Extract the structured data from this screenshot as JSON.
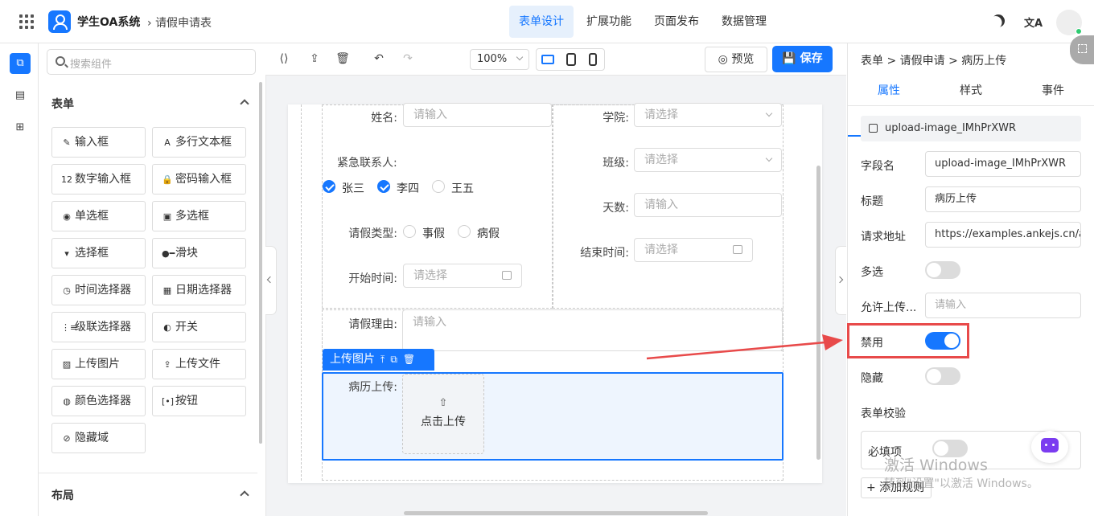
{
  "app": {
    "title": "学生OA系统",
    "breadcrumb": "请假申请表"
  },
  "topnav": [
    {
      "label": "表单设计",
      "active": true
    },
    {
      "label": "扩展功能",
      "active": false
    },
    {
      "label": "页面发布",
      "active": false
    },
    {
      "label": "数据管理",
      "active": false
    }
  ],
  "topbar": {
    "translate_glyph": "文A"
  },
  "left": {
    "search_placeholder": "搜索组件",
    "form_section": "表单",
    "layout_section": "布局",
    "components": [
      {
        "label": "输入框",
        "icon": "pen-icon",
        "glyph": "✎"
      },
      {
        "label": "多行文本框",
        "icon": "textarea-icon",
        "glyph": "A"
      },
      {
        "label": "数字输入框",
        "icon": "number-icon",
        "glyph": "12"
      },
      {
        "label": "密码输入框",
        "icon": "lock-icon",
        "glyph": "🔒"
      },
      {
        "label": "单选框",
        "icon": "radio-icon",
        "glyph": "◉"
      },
      {
        "label": "多选框",
        "icon": "checkbox-icon",
        "glyph": "▣"
      },
      {
        "label": "选择框",
        "icon": "select-icon",
        "glyph": "▾"
      },
      {
        "label": "滑块",
        "icon": "slider-icon",
        "glyph": "●━"
      },
      {
        "label": "时间选择器",
        "icon": "clock-icon",
        "glyph": "◷"
      },
      {
        "label": "日期选择器",
        "icon": "calendar-icon",
        "glyph": "▦"
      },
      {
        "label": "级联选择器",
        "icon": "cascader-icon",
        "glyph": "⋮≡"
      },
      {
        "label": "开关",
        "icon": "switch-icon",
        "glyph": "◐"
      },
      {
        "label": "上传图片",
        "icon": "image-icon",
        "glyph": "▨"
      },
      {
        "label": "上传文件",
        "icon": "upload-icon",
        "glyph": "⇪"
      },
      {
        "label": "颜色选择器",
        "icon": "palette-icon",
        "glyph": "◍"
      },
      {
        "label": "按钮",
        "icon": "button-icon",
        "glyph": "[•]"
      },
      {
        "label": "隐藏域",
        "icon": "eye-off-icon",
        "glyph": "⊘"
      }
    ]
  },
  "toolbar": {
    "zoom": "100%",
    "preview_label": "预览",
    "save_label": "保存"
  },
  "form": {
    "name_label": "姓名:",
    "name_placeholder": "请输入",
    "college_label": "学院:",
    "college_placeholder": "请选择",
    "contact_label": "紧急联系人:",
    "contacts": [
      {
        "label": "张三",
        "checked": true
      },
      {
        "label": "李四",
        "checked": true
      },
      {
        "label": "王五",
        "checked": false
      }
    ],
    "class_label": "班级:",
    "class_placeholder": "请选择",
    "days_label": "天数:",
    "days_placeholder": "请输入",
    "leave_type_label": "请假类型:",
    "leave_types": [
      "事假",
      "病假"
    ],
    "end_time_label": "结束时间:",
    "end_time_placeholder": "请选择",
    "start_time_label": "开始时间:",
    "start_time_placeholder": "请选择",
    "reason_label": "请假理由:",
    "reason_placeholder": "请输入",
    "selected_tag": "上传图片",
    "record_label": "病历上传:",
    "upload_text": "点击上传"
  },
  "right": {
    "breadcrumb": "表单 > 请假申请 > 病历上传",
    "tabs": [
      {
        "label": "属性",
        "active": true
      },
      {
        "label": "样式",
        "active": false
      },
      {
        "label": "事件",
        "active": false
      }
    ],
    "component_id": "upload-image_IMhPrXWR",
    "field_name_label": "字段名",
    "field_name_value": "upload-image_IMhPrXWR",
    "title_label": "标题",
    "title_value": "病历上传",
    "url_label": "请求地址",
    "url_value": "https://examples.ankejs.cn/a",
    "multiple_label": "多选",
    "multiple_on": false,
    "allow_label": "允许上传...",
    "allow_placeholder": "请输入",
    "disabled_label": "禁用",
    "disabled_on": true,
    "hidden_label": "隐藏",
    "hidden_on": false,
    "validation_label": "表单校验",
    "required_label": "必填项",
    "required_on": false,
    "add_rule_label": "+ 添加规则"
  },
  "watermark": {
    "line1": "激活 Windows",
    "line2": "转到\"设置\"以激活 Windows。"
  },
  "colors": {
    "accent": "#1677ff",
    "annotation": "#e84a4a"
  }
}
